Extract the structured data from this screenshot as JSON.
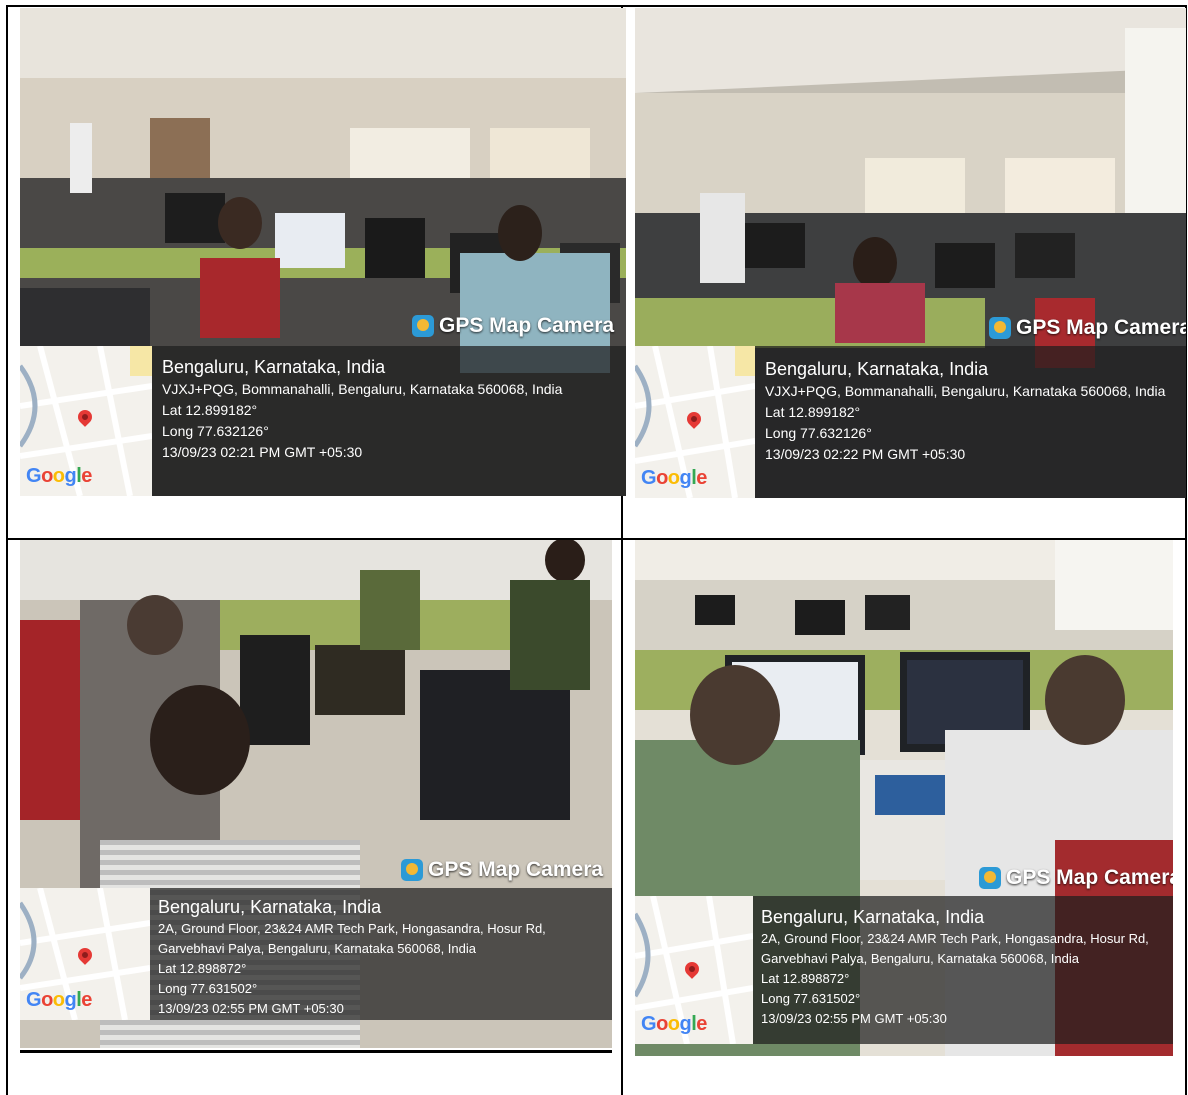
{
  "photos": [
    {
      "brand": "GPS Map Camera",
      "city": "Bengaluru, Karnataka, India",
      "address": [
        "VJXJ+PQG, Bommanahalli, Bengaluru, Karnataka 560068, India"
      ],
      "lat": "Lat 12.899182°",
      "long": "Long 77.632126°",
      "datetime": "13/09/23 02:21 PM GMT +05:30"
    },
    {
      "brand": "GPS Map Camera",
      "city": "Bengaluru, Karnataka, India",
      "address": [
        "VJXJ+PQG, Bommanahalli, Bengaluru, Karnataka 560068, India"
      ],
      "lat": "Lat 12.899182°",
      "long": "Long 77.632126°",
      "datetime": "13/09/23 02:22 PM GMT +05:30"
    },
    {
      "brand": "GPS Map Camera",
      "city": "Bengaluru, Karnataka, India",
      "address": [
        "2A, Ground Floor, 23&24 AMR Tech Park, Hongasandra, Hosur Rd,",
        "Garvebhavi Palya, Bengaluru, Karnataka 560068, India"
      ],
      "lat": "Lat 12.898872°",
      "long": "Long 77.631502°",
      "datetime": "13/09/23 02:55 PM GMT +05:30"
    },
    {
      "brand": "GPS Map Camera",
      "city": "Bengaluru, Karnataka, India",
      "address": [
        "2A, Ground Floor, 23&24 AMR Tech Park, Hongasandra, Hosur Rd,",
        "Garvebhavi Palya, Bengaluru, Karnataka 560068, India"
      ],
      "lat": "Lat 12.898872°",
      "long": "Long 77.631502°",
      "datetime": "13/09/23 02:55 PM GMT +05:30"
    }
  ],
  "map_label": "Google",
  "icons": {
    "brand": "gps-map-camera-icon",
    "pin": "map-pin-icon"
  },
  "colors": {
    "overlay": "#1e1e1e",
    "pin": "#e53935",
    "brand_icon": "#2c9ad6"
  }
}
